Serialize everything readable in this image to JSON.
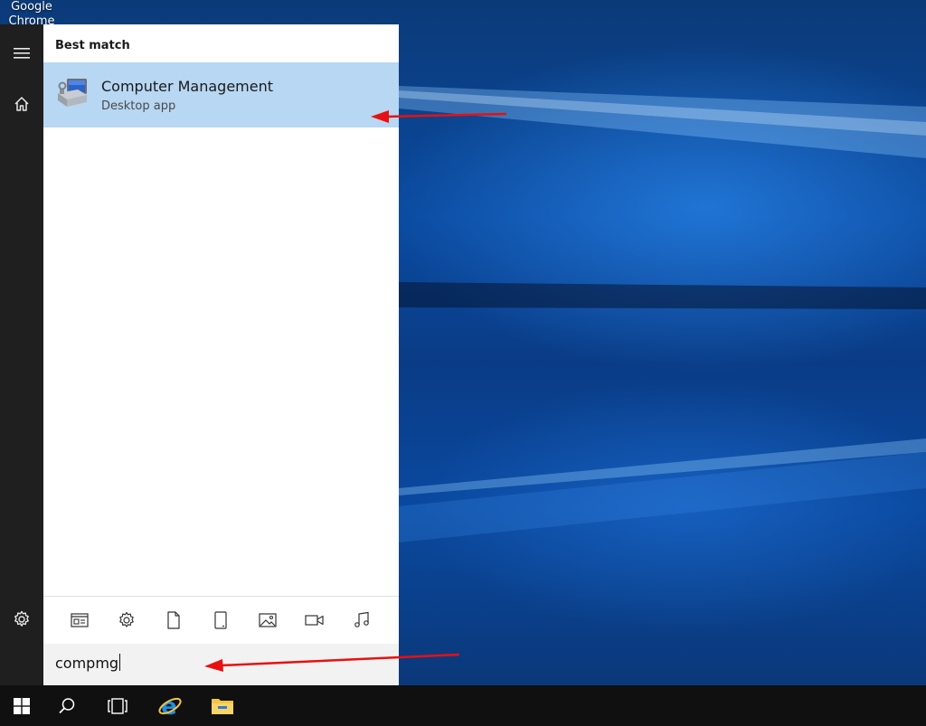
{
  "desktop": {
    "chrome_icon_label": "Google Chrome"
  },
  "start_rail": {
    "icons": [
      "hamburger-menu-icon",
      "home-icon",
      "settings-icon"
    ]
  },
  "search": {
    "best_match_header": "Best match",
    "result": {
      "title": "Computer Management",
      "subtitle": "Desktop app",
      "icon": "computer-management-icon"
    },
    "filters": [
      "apps-filter-icon",
      "settings-filter-icon",
      "documents-filter-icon",
      "tablet-filter-icon",
      "photos-filter-icon",
      "videos-filter-icon",
      "music-filter-icon"
    ],
    "query": "compmg"
  },
  "taskbar": {
    "items": [
      "windows-start-icon",
      "search-icon",
      "task-view-icon",
      "internet-explorer-icon",
      "file-explorer-icon"
    ]
  },
  "colors": {
    "selection": "#b7d7f3",
    "rail": "#1f1f1f",
    "taskbar": "#101010",
    "annotation": "#e81010",
    "ie_blue": "#1e8fe0",
    "folder_yellow": "#f3c545"
  }
}
